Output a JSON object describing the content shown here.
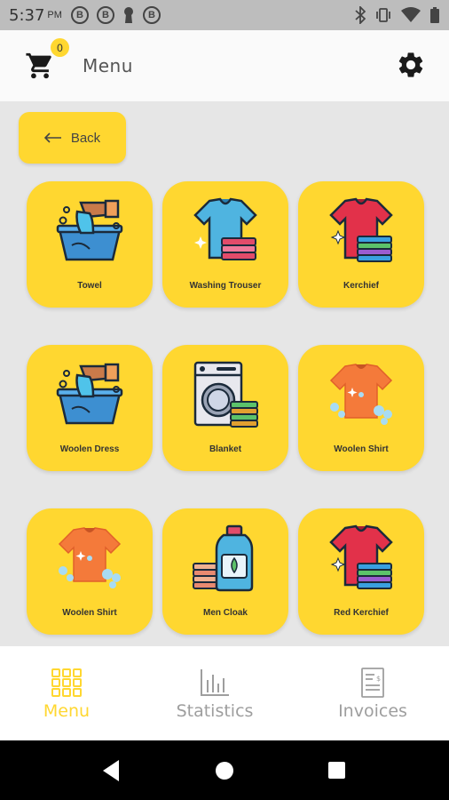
{
  "status_bar": {
    "time": "5:37",
    "ampm": "PM",
    "notif_icons": [
      "B",
      "B",
      "B"
    ]
  },
  "app_bar": {
    "title": "Menu",
    "cart_count": "0"
  },
  "back_button": {
    "label": "Back"
  },
  "tiles": [
    {
      "label": "Towel",
      "icon": "washing-basin-icon"
    },
    {
      "label": "Washing Trouser",
      "icon": "blue-tshirt-icon"
    },
    {
      "label": "Kerchief",
      "icon": "red-tshirt-icon"
    },
    {
      "label": "Woolen Dress",
      "icon": "washing-basin-icon"
    },
    {
      "label": "Blanket",
      "icon": "washing-machine-icon"
    },
    {
      "label": "Woolen Shirt",
      "icon": "orange-tshirt-bubbles-icon"
    },
    {
      "label": "Woolen Shirt",
      "icon": "orange-tshirt-bubbles-icon"
    },
    {
      "label": "Men Cloak",
      "icon": "detergent-bottle-icon"
    },
    {
      "label": "Red Kerchief",
      "icon": "red-tshirt-icon"
    }
  ],
  "bottom_nav": {
    "items": [
      {
        "label": "Menu",
        "icon": "grid-icon",
        "active": true
      },
      {
        "label": "Statistics",
        "icon": "bar-chart-icon",
        "active": false
      },
      {
        "label": "Invoices",
        "icon": "invoice-icon",
        "active": false
      }
    ]
  },
  "colors": {
    "accent": "#ffd730",
    "background": "#e6e6e6",
    "active_nav": "#ffd730",
    "inactive_nav": "#9e9e9e"
  }
}
